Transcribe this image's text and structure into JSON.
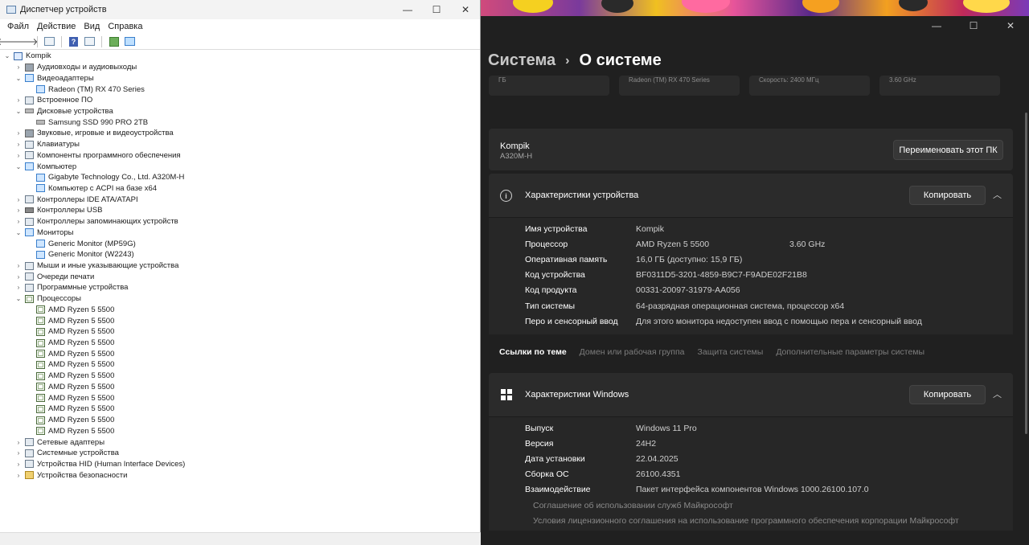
{
  "device_manager": {
    "title": "Диспетчер устройств",
    "menu": [
      "Файл",
      "Действие",
      "Вид",
      "Справка"
    ],
    "tree": [
      {
        "label": "Kompik",
        "level": 0,
        "expanded": true,
        "icon": "computer"
      },
      {
        "label": "Аудиовходы и аудиовыходы",
        "level": 1,
        "expanded": false,
        "icon": "sound"
      },
      {
        "label": "Видеоадаптеры",
        "level": 1,
        "expanded": true,
        "icon": "monitor"
      },
      {
        "label": "Radeon (TM) RX 470 Series",
        "level": 2,
        "icon": "monitor"
      },
      {
        "label": "Встроенное ПО",
        "level": 1,
        "expanded": false,
        "icon": "chip"
      },
      {
        "label": "Дисковые устройства",
        "level": 1,
        "expanded": true,
        "icon": "disk"
      },
      {
        "label": "Samsung SSD 990 PRO 2TB",
        "level": 2,
        "icon": "disk"
      },
      {
        "label": "Звуковые, игровые и видеоустройства",
        "level": 1,
        "expanded": false,
        "icon": "sound"
      },
      {
        "label": "Клавиатуры",
        "level": 1,
        "expanded": false,
        "icon": "keyboard"
      },
      {
        "label": "Компоненты программного обеспечения",
        "level": 1,
        "expanded": false,
        "icon": "chip"
      },
      {
        "label": "Компьютер",
        "level": 1,
        "expanded": true,
        "icon": "monitor"
      },
      {
        "label": "Gigabyte Technology Co., Ltd. A320M-H",
        "level": 2,
        "icon": "monitor"
      },
      {
        "label": "Компьютер с ACPI на базе x64",
        "level": 2,
        "icon": "monitor"
      },
      {
        "label": "Контроллеры IDE ATA/ATAPI",
        "level": 1,
        "expanded": false,
        "icon": "chip"
      },
      {
        "label": "Контроллеры USB",
        "level": 1,
        "expanded": false,
        "icon": "usb"
      },
      {
        "label": "Контроллеры запоминающих устройств",
        "level": 1,
        "expanded": false,
        "icon": "chip"
      },
      {
        "label": "Мониторы",
        "level": 1,
        "expanded": true,
        "icon": "monitor"
      },
      {
        "label": "Generic Monitor (MP59G)",
        "level": 2,
        "icon": "monitor"
      },
      {
        "label": "Generic Monitor (W2243)",
        "level": 2,
        "icon": "monitor"
      },
      {
        "label": "Мыши и иные указывающие устройства",
        "level": 1,
        "expanded": false,
        "icon": "mouse"
      },
      {
        "label": "Очереди печати",
        "level": 1,
        "expanded": false,
        "icon": "printer"
      },
      {
        "label": "Программные устройства",
        "level": 1,
        "expanded": false,
        "icon": "chip"
      },
      {
        "label": "Процессоры",
        "level": 1,
        "expanded": true,
        "icon": "cpu"
      },
      {
        "label": "AMD Ryzen 5 5500",
        "level": 2,
        "icon": "cpu"
      },
      {
        "label": "AMD Ryzen 5 5500",
        "level": 2,
        "icon": "cpu"
      },
      {
        "label": "AMD Ryzen 5 5500",
        "level": 2,
        "icon": "cpu"
      },
      {
        "label": "AMD Ryzen 5 5500",
        "level": 2,
        "icon": "cpu"
      },
      {
        "label": "AMD Ryzen 5 5500",
        "level": 2,
        "icon": "cpu"
      },
      {
        "label": "AMD Ryzen 5 5500",
        "level": 2,
        "icon": "cpu"
      },
      {
        "label": "AMD Ryzen 5 5500",
        "level": 2,
        "icon": "cpu"
      },
      {
        "label": "AMD Ryzen 5 5500",
        "level": 2,
        "icon": "cpu"
      },
      {
        "label": "AMD Ryzen 5 5500",
        "level": 2,
        "icon": "cpu"
      },
      {
        "label": "AMD Ryzen 5 5500",
        "level": 2,
        "icon": "cpu"
      },
      {
        "label": "AMD Ryzen 5 5500",
        "level": 2,
        "icon": "cpu"
      },
      {
        "label": "AMD Ryzen 5 5500",
        "level": 2,
        "icon": "cpu"
      },
      {
        "label": "Сетевые адаптеры",
        "level": 1,
        "expanded": false,
        "icon": "network"
      },
      {
        "label": "Системные устройства",
        "level": 1,
        "expanded": false,
        "icon": "chip"
      },
      {
        "label": "Устройства HID (Human Interface Devices)",
        "level": 1,
        "expanded": false,
        "icon": "hid"
      },
      {
        "label": "Устройства безопасности",
        "level": 1,
        "expanded": false,
        "icon": "security"
      }
    ]
  },
  "settings": {
    "breadcrumb": {
      "parent": "Система",
      "current": "О системе"
    },
    "specs_strip": [
      "ГБ",
      "Radeon (TM) RX 470 Series",
      "Скорость: 2400 МГц",
      "3.60 GHz"
    ],
    "pc": {
      "name": "Kompik",
      "model": "A320M-H",
      "rename_label": "Переименовать этот ПК"
    },
    "device_specs": {
      "title": "Характеристики устройства",
      "copy_label": "Копировать",
      "rows": [
        {
          "key": "Имя устройства",
          "value": "Kompik",
          "extra": ""
        },
        {
          "key": "Процессор",
          "value": "AMD Ryzen 5 5500",
          "extra": "3.60 GHz"
        },
        {
          "key": "Оперативная память",
          "value": "16,0 ГБ (доступно: 15,9 ГБ)",
          "extra": ""
        },
        {
          "key": "Код устройства",
          "value": "BF0311D5-3201-4859-B9C7-F9ADE02F21B8",
          "extra": ""
        },
        {
          "key": "Код продукта",
          "value": "00331-20097-31979-AA056",
          "extra": ""
        },
        {
          "key": "Тип системы",
          "value": "64-разрядная операционная система, процессор x64",
          "extra": ""
        },
        {
          "key": "Перо и сенсорный ввод",
          "value": "Для этого монитора недоступен ввод с помощью пера и сенсорный ввод",
          "extra": ""
        }
      ]
    },
    "related": {
      "label": "Ссылки по теме",
      "links": [
        "Домен или рабочая группа",
        "Защита системы",
        "Дополнительные параметры системы"
      ]
    },
    "windows_specs": {
      "title": "Характеристики Windows",
      "copy_label": "Копировать",
      "rows": [
        {
          "key": "Выпуск",
          "value": "Windows 11 Pro"
        },
        {
          "key": "Версия",
          "value": "24H2"
        },
        {
          "key": "Дата установки",
          "value": "22.04.2025"
        },
        {
          "key": "Сборка ОС",
          "value": "26100.4351"
        },
        {
          "key": "Взаимодействие",
          "value": "Пакет интерфейса компонентов Windows 1000.26100.107.0"
        }
      ],
      "links": [
        "Соглашение об использовании служб Майкрософт",
        "Условия лицензионного соглашения на использование программного обеспечения корпорации Майкрософт"
      ]
    }
  }
}
